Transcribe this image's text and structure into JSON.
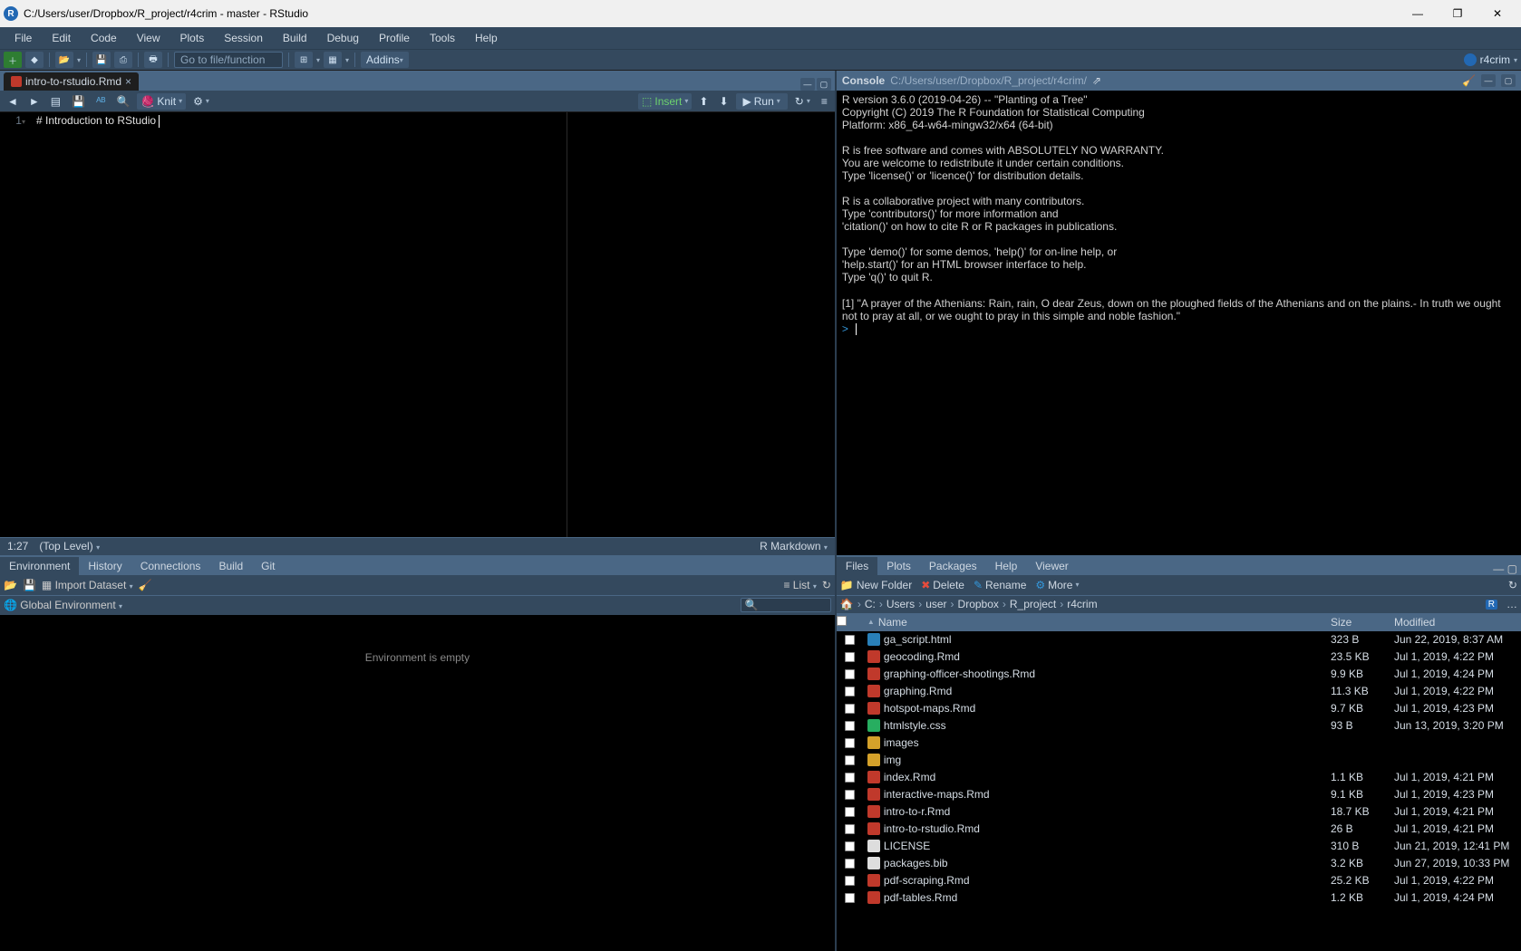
{
  "titlebar": {
    "title": "C:/Users/user/Dropbox/R_project/r4crim - master - RStudio"
  },
  "menubar": [
    "File",
    "Edit",
    "Code",
    "View",
    "Plots",
    "Session",
    "Build",
    "Debug",
    "Profile",
    "Tools",
    "Help"
  ],
  "toolbar": {
    "goto_placeholder": "Go to file/function",
    "addins": "Addins",
    "project": "r4crim"
  },
  "source": {
    "tab_name": "intro-to-rstudio.Rmd",
    "knit": "Knit",
    "insert": "Insert",
    "run": "Run",
    "line_no": "1",
    "code": "# Introduction to RStudio ",
    "status_pos": "1:27",
    "status_scope": "(Top Level)",
    "status_type": "R Markdown"
  },
  "env": {
    "tabs": [
      "Environment",
      "History",
      "Connections",
      "Build",
      "Git"
    ],
    "import": "Import Dataset",
    "list": "List",
    "scope": "Global Environment",
    "empty": "Environment is empty"
  },
  "console": {
    "title": "Console",
    "path": "C:/Users/user/Dropbox/R_project/r4crim/",
    "text": "R version 3.6.0 (2019-04-26) -- \"Planting of a Tree\"\nCopyright (C) 2019 The R Foundation for Statistical Computing\nPlatform: x86_64-w64-mingw32/x64 (64-bit)\n\nR is free software and comes with ABSOLUTELY NO WARRANTY.\nYou are welcome to redistribute it under certain conditions.\nType 'license()' or 'licence()' for distribution details.\n\nR is a collaborative project with many contributors.\nType 'contributors()' for more information and\n'citation()' on how to cite R or R packages in publications.\n\nType 'demo()' for some demos, 'help()' for on-line help, or\n'help.start()' for an HTML browser interface to help.\nType 'q()' to quit R.\n\n[1] \"A prayer of the Athenians: Rain, rain, O dear Zeus, down on the ploughed fields of the Athenians and on the plains.- In truth we ought not to pray at all, or we ought to pray in this simple and noble fashion.\""
  },
  "files": {
    "tabs": [
      "Files",
      "Plots",
      "Packages",
      "Help",
      "Viewer"
    ],
    "new_folder": "New Folder",
    "delete": "Delete",
    "rename": "Rename",
    "more": "More",
    "breadcrumb": [
      "C:",
      "Users",
      "user",
      "Dropbox",
      "R_project",
      "r4crim"
    ],
    "hdr_name": "Name",
    "hdr_size": "Size",
    "hdr_mod": "Modified",
    "rows": [
      {
        "icon": "html",
        "name": "ga_script.html",
        "size": "323 B",
        "mod": "Jun 22, 2019, 8:37 AM"
      },
      {
        "icon": "rmd",
        "name": "geocoding.Rmd",
        "size": "23.5 KB",
        "mod": "Jul 1, 2019, 4:22 PM"
      },
      {
        "icon": "rmd",
        "name": "graphing-officer-shootings.Rmd",
        "size": "9.9 KB",
        "mod": "Jul 1, 2019, 4:24 PM"
      },
      {
        "icon": "rmd",
        "name": "graphing.Rmd",
        "size": "11.3 KB",
        "mod": "Jul 1, 2019, 4:22 PM"
      },
      {
        "icon": "rmd",
        "name": "hotspot-maps.Rmd",
        "size": "9.7 KB",
        "mod": "Jul 1, 2019, 4:23 PM"
      },
      {
        "icon": "css",
        "name": "htmlstyle.css",
        "size": "93 B",
        "mod": "Jun 13, 2019, 3:20 PM"
      },
      {
        "icon": "folder",
        "name": "images",
        "size": "",
        "mod": ""
      },
      {
        "icon": "folder",
        "name": "img",
        "size": "",
        "mod": ""
      },
      {
        "icon": "rmd",
        "name": "index.Rmd",
        "size": "1.1 KB",
        "mod": "Jul 1, 2019, 4:21 PM"
      },
      {
        "icon": "rmd",
        "name": "interactive-maps.Rmd",
        "size": "9.1 KB",
        "mod": "Jul 1, 2019, 4:23 PM"
      },
      {
        "icon": "rmd",
        "name": "intro-to-r.Rmd",
        "size": "18.7 KB",
        "mod": "Jul 1, 2019, 4:21 PM"
      },
      {
        "icon": "rmd",
        "name": "intro-to-rstudio.Rmd",
        "size": "26 B",
        "mod": "Jul 1, 2019, 4:21 PM"
      },
      {
        "icon": "txt",
        "name": "LICENSE",
        "size": "310 B",
        "mod": "Jun 21, 2019, 12:41 PM"
      },
      {
        "icon": "txt",
        "name": "packages.bib",
        "size": "3.2 KB",
        "mod": "Jun 27, 2019, 10:33 PM"
      },
      {
        "icon": "rmd",
        "name": "pdf-scraping.Rmd",
        "size": "25.2 KB",
        "mod": "Jul 1, 2019, 4:22 PM"
      },
      {
        "icon": "rmd",
        "name": "pdf-tables.Rmd",
        "size": "1.2 KB",
        "mod": "Jul 1, 2019, 4:24 PM"
      }
    ]
  }
}
